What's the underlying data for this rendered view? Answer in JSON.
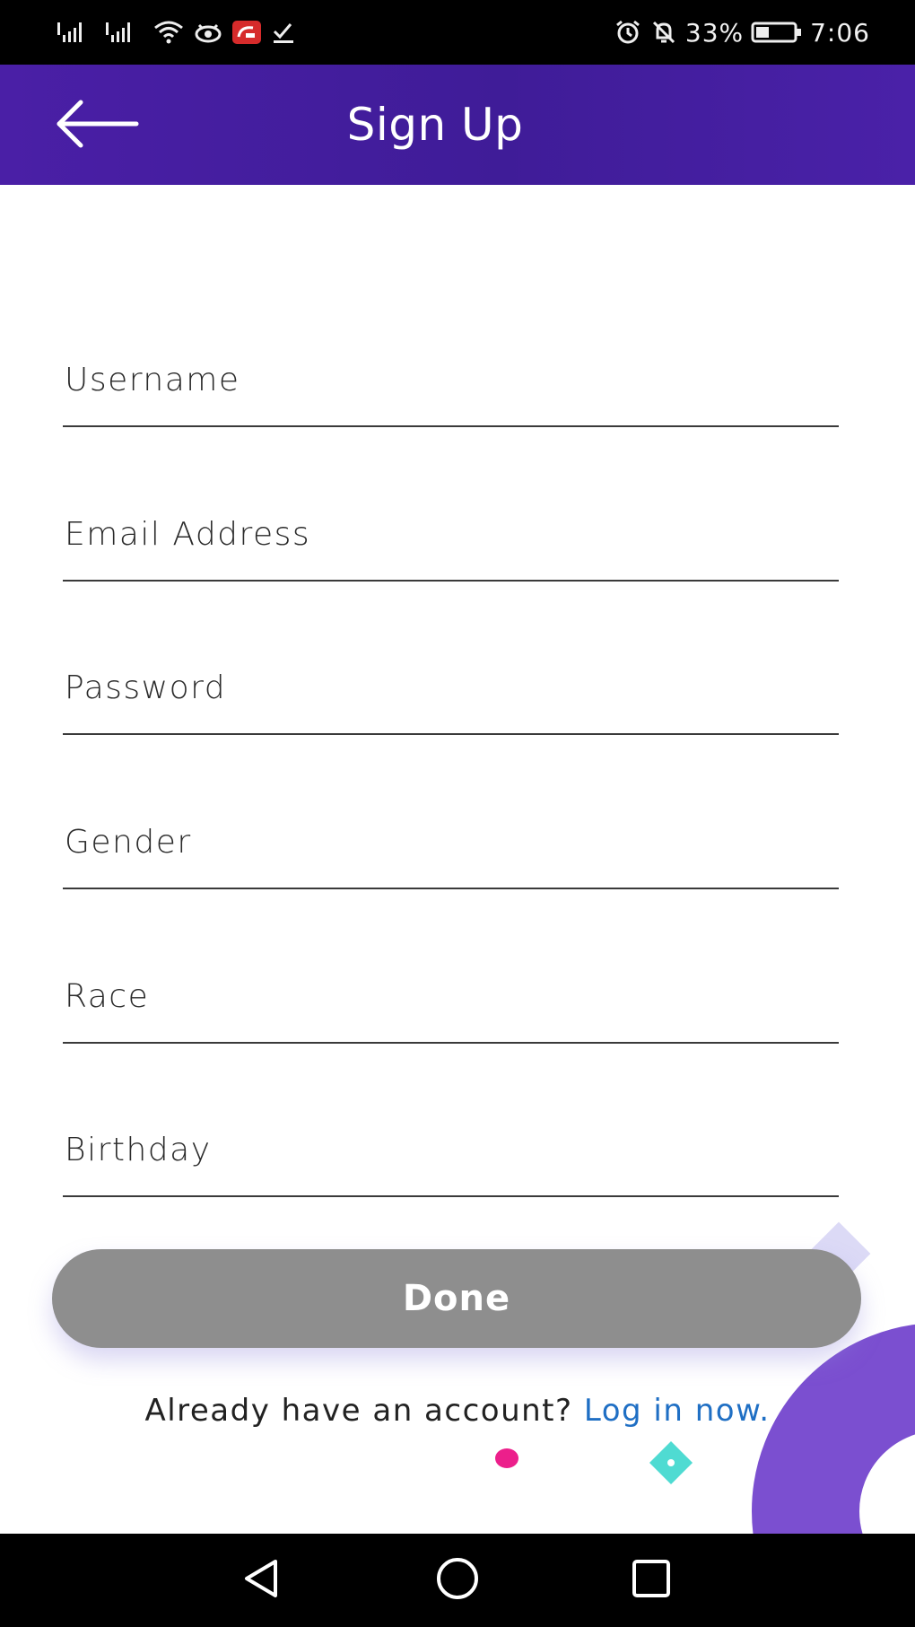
{
  "status_bar": {
    "signal_left": "signal-icon",
    "battery_percent": "33%",
    "time": "7:06",
    "icons": [
      "signal-icon",
      "signal-icon",
      "wifi-icon",
      "eye-icon",
      "notification-app-icon",
      "download-done-icon",
      "alarm-icon",
      "mute-icon",
      "battery-icon"
    ]
  },
  "app_bar": {
    "title": "Sign Up",
    "back_icon": "back-arrow-icon",
    "background_color": "#4a1fa6"
  },
  "form": {
    "fields": [
      {
        "label": "Username",
        "value": ""
      },
      {
        "label": "Email Address",
        "value": ""
      },
      {
        "label": "Password",
        "value": ""
      },
      {
        "label": "Gender",
        "value": ""
      },
      {
        "label": "Race",
        "value": ""
      },
      {
        "label": "Birthday",
        "value": ""
      }
    ]
  },
  "actions": {
    "done_label": "Done",
    "done_color": "#8e8e8e",
    "login_prompt": "Already have an account? ",
    "login_link": "Log in now.",
    "link_color": "#1f6fc4"
  },
  "nav_bar": {
    "icons": [
      "nav-back-icon",
      "nav-home-icon",
      "nav-recents-icon"
    ]
  },
  "colors": {
    "accent_purple": "#7b4fd0",
    "pink_dot": "#ec1f8b",
    "teal_diamond": "#4fdbd2"
  }
}
